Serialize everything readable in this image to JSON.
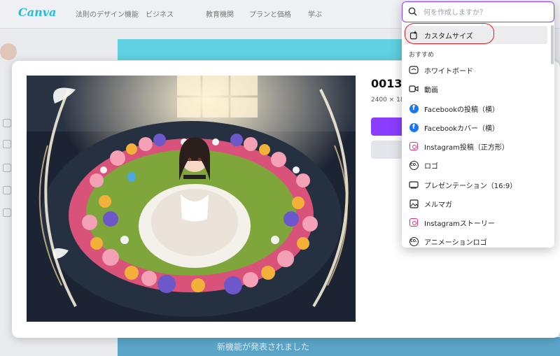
{
  "app": {
    "logo": "Canva",
    "nav": [
      "法則のデザイン機能",
      "ビジネス",
      "教育機関",
      "プランと価格",
      "学ぶ"
    ],
    "banner_text": "",
    "bottom_text": "新機能が発表されました"
  },
  "modal": {
    "title": "00133",
    "dimensions": "2400 × 18"
  },
  "dropdown": {
    "search_placeholder": "何を作成しますか？",
    "top_item": {
      "label": "カスタムサイズ",
      "icon": "custom-size-icon"
    },
    "section_label": "おすすめ",
    "items": [
      {
        "label": "ホワイトボード",
        "icon": "whiteboard-icon"
      },
      {
        "label": "動画",
        "icon": "video-icon"
      },
      {
        "label": "Facebookの投稿（横）",
        "icon": "facebook-icon"
      },
      {
        "label": "Facebookカバー（横）",
        "icon": "facebook-icon"
      },
      {
        "label": "Instagram投稿（正方形）",
        "icon": "instagram-icon"
      },
      {
        "label": "ロゴ",
        "icon": "logo-icon"
      },
      {
        "label": "プレゼンテーション（16:9）",
        "icon": "presentation-icon"
      },
      {
        "label": "メルマガ",
        "icon": "newsletter-icon"
      },
      {
        "label": "Instagramストーリー",
        "icon": "instagram-icon"
      },
      {
        "label": "アニメーションロゴ",
        "icon": "animated-logo-icon"
      }
    ]
  },
  "colors": {
    "accent": "#8b3dff",
    "facebook": "#1877f2",
    "instagram": "#e1306c",
    "annotation": "#e01b1b"
  }
}
